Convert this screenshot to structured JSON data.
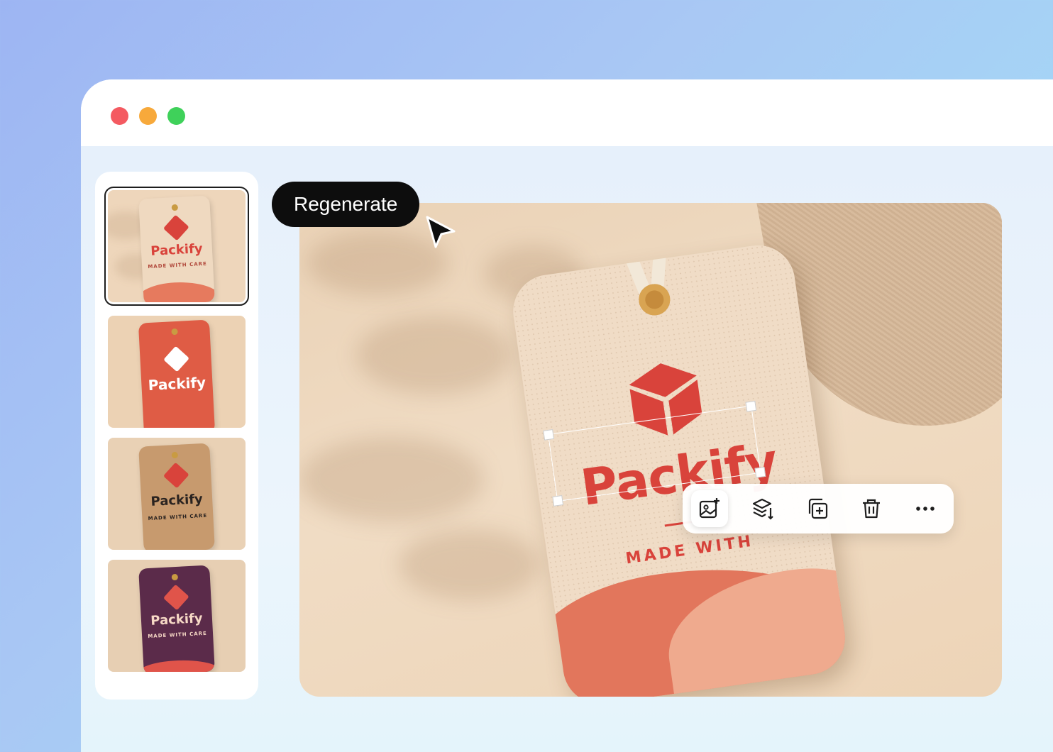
{
  "window": {
    "controls": [
      "close",
      "minimize",
      "maximize"
    ]
  },
  "thumbnails": [
    {
      "brand": "Packify",
      "subtitle": "MADE WITH CARE",
      "tag_color": "#efd9c0",
      "text_color": "#d9433b",
      "selected": true
    },
    {
      "brand": "Packify",
      "subtitle": "",
      "tag_color": "#df5c45",
      "text_color": "#ffffff",
      "selected": false
    },
    {
      "brand": "Packify",
      "subtitle": "MADE WITH CARE",
      "tag_color": "#c79a6e",
      "text_color": "#2a2320",
      "selected": false
    },
    {
      "brand": "Packify",
      "subtitle": "MADE WITH CARE",
      "tag_color": "#5b2b4a",
      "text_color": "#f7d9c6",
      "selected": false
    }
  ],
  "main": {
    "brand": "Packify",
    "subtitle": "MADE WITH",
    "accent": "#d9433b"
  },
  "tooltip": {
    "label": "Regenerate"
  },
  "toolbar": {
    "tools": [
      "image-edit-icon",
      "layers-icon",
      "duplicate-icon",
      "trash-icon",
      "more-icon"
    ]
  }
}
